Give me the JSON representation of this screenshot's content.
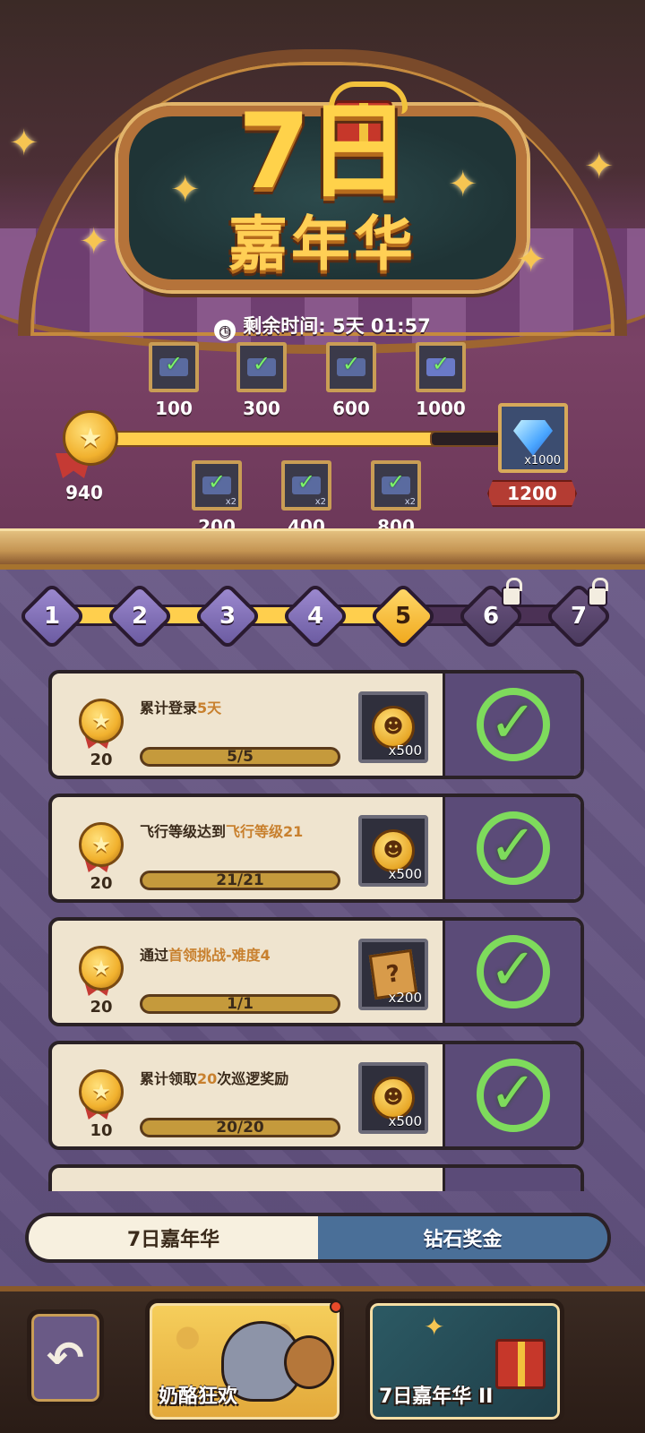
{
  "header": {
    "title_main": "7日",
    "title_sub": "嘉年华",
    "timer_label": "剩余时间:",
    "timer_value": "5天  01:57"
  },
  "milestones": {
    "current_points": "940",
    "top": [
      {
        "label": "100"
      },
      {
        "label": "300"
      },
      {
        "label": "600"
      },
      {
        "label": "1000"
      }
    ],
    "bottom": [
      {
        "label": "200",
        "qty": "x2"
      },
      {
        "label": "400",
        "qty": "x2"
      },
      {
        "label": "800",
        "qty": "x2"
      }
    ],
    "final": {
      "label": "1200",
      "qty": "x1000",
      "icon": "diamond-icon"
    }
  },
  "day_steps": {
    "items": [
      "1",
      "2",
      "3",
      "4",
      "5",
      "6",
      "7"
    ],
    "active": 5,
    "locked": [
      6,
      7
    ]
  },
  "tasks": [
    {
      "points": "20",
      "text_a": "累计登录",
      "text_hl": "5天",
      "text_b": "",
      "progress": "5/5",
      "reward_qty": "x500",
      "reward_icon": "coin-icon",
      "status": "completed"
    },
    {
      "points": "20",
      "text_a": "飞行等级达到",
      "text_hl": "飞行等级21",
      "text_b": "",
      "progress": "21/21",
      "reward_qty": "x500",
      "reward_icon": "coin-icon",
      "status": "completed"
    },
    {
      "points": "20",
      "text_a": "通过",
      "text_hl": "首领挑战-难度4",
      "text_b": "",
      "progress": "1/1",
      "reward_qty": "x200",
      "reward_icon": "map-scroll-icon",
      "status": "completed"
    },
    {
      "points": "10",
      "text_a": "累计领取",
      "text_hl": "20",
      "text_b": "次巡逻奖励",
      "progress": "20/20",
      "reward_qty": "x500",
      "reward_icon": "coin-icon",
      "status": "completed"
    }
  ],
  "tabs": [
    {
      "label": "7日嘉年华",
      "active": true
    },
    {
      "label": "钻石奖金",
      "active": false
    }
  ],
  "bottom_bar": {
    "back_icon": "back-arrow-icon",
    "events": [
      {
        "label": "奶酪狂欢",
        "badge": true
      },
      {
        "label": "7日嘉年华 II",
        "badge": false
      }
    ]
  },
  "colors": {
    "accent_gold": "#ffcf4d",
    "panel_purple": "#6a5a86",
    "complete_green": "#7edb5c",
    "highlight_orange": "#c8802e"
  }
}
